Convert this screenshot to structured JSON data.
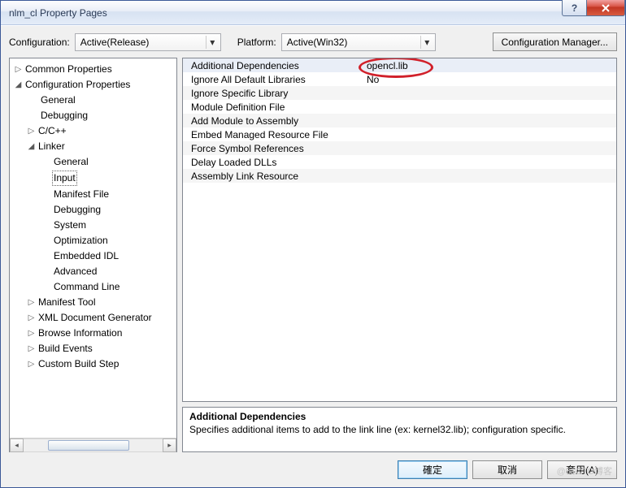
{
  "window": {
    "title": "nlm_cl Property Pages"
  },
  "config": {
    "label": "Configuration:",
    "value": "Active(Release)",
    "platform_label": "Platform:",
    "platform_value": "Active(Win32)",
    "manager_btn": "Configuration Manager..."
  },
  "tree": {
    "common": "Common Properties",
    "config": "Configuration Properties",
    "general": "General",
    "debugging": "Debugging",
    "cpp": "C/C++",
    "linker": "Linker",
    "linker_general": "General",
    "linker_input": "Input",
    "linker_manifest": "Manifest File",
    "linker_debugging": "Debugging",
    "linker_system": "System",
    "linker_opt": "Optimization",
    "linker_idl": "Embedded IDL",
    "linker_adv": "Advanced",
    "linker_cmd": "Command Line",
    "manifest_tool": "Manifest Tool",
    "xml_gen": "XML Document Generator",
    "browse": "Browse Information",
    "build_events": "Build Events",
    "custom": "Custom Build Step"
  },
  "grid": {
    "rows": [
      {
        "name": "Additional Dependencies",
        "value": "opencl.lib"
      },
      {
        "name": "Ignore All Default Libraries",
        "value": "No"
      },
      {
        "name": "Ignore Specific Library",
        "value": ""
      },
      {
        "name": "Module Definition File",
        "value": ""
      },
      {
        "name": "Add Module to Assembly",
        "value": ""
      },
      {
        "name": "Embed Managed Resource File",
        "value": ""
      },
      {
        "name": "Force Symbol References",
        "value": ""
      },
      {
        "name": "Delay Loaded DLLs",
        "value": ""
      },
      {
        "name": "Assembly Link Resource",
        "value": ""
      }
    ]
  },
  "desc": {
    "title": "Additional Dependencies",
    "text": "Specifies additional items to add to the link line (ex: kernel32.lib); configuration specific."
  },
  "footer": {
    "ok": "確定",
    "cancel": "取消",
    "apply": "套用(A)"
  },
  "watermark": "@51CTO博客"
}
